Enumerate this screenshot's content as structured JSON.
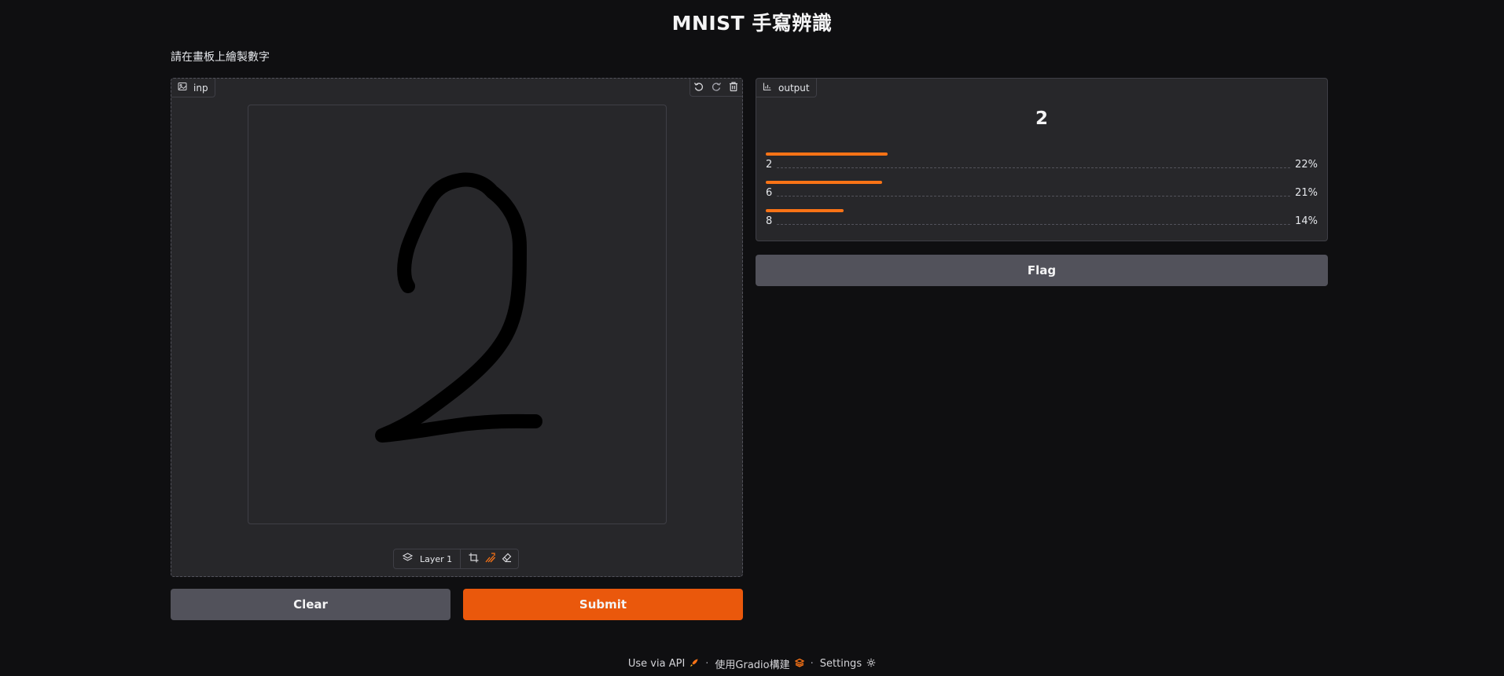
{
  "app": {
    "title": "MNIST 手寫辨識",
    "description": "請在畫板上繪製數字"
  },
  "input": {
    "label": "inp",
    "tools": [
      "undo-icon",
      "redo-icon",
      "trash-icon"
    ],
    "drawn_digit": "2",
    "layer_label": "Layer 1",
    "stroke_color": "#000000"
  },
  "output": {
    "label": "output",
    "top_label": "2",
    "confidences": [
      {
        "label": "2",
        "percent": "22%",
        "value": 0.22
      },
      {
        "label": "6",
        "percent": "21%",
        "value": 0.21
      },
      {
        "label": "8",
        "percent": "14%",
        "value": 0.14
      }
    ]
  },
  "buttons": {
    "clear": "Clear",
    "submit": "Submit",
    "flag": "Flag"
  },
  "footer": {
    "api": "Use via API",
    "built_with": "使用Gradio構建",
    "settings": "Settings",
    "separator": "·"
  },
  "colors": {
    "accent": "#ea580c",
    "bar": "#f97316",
    "background": "#0f0f11",
    "panel": "#27272a"
  }
}
